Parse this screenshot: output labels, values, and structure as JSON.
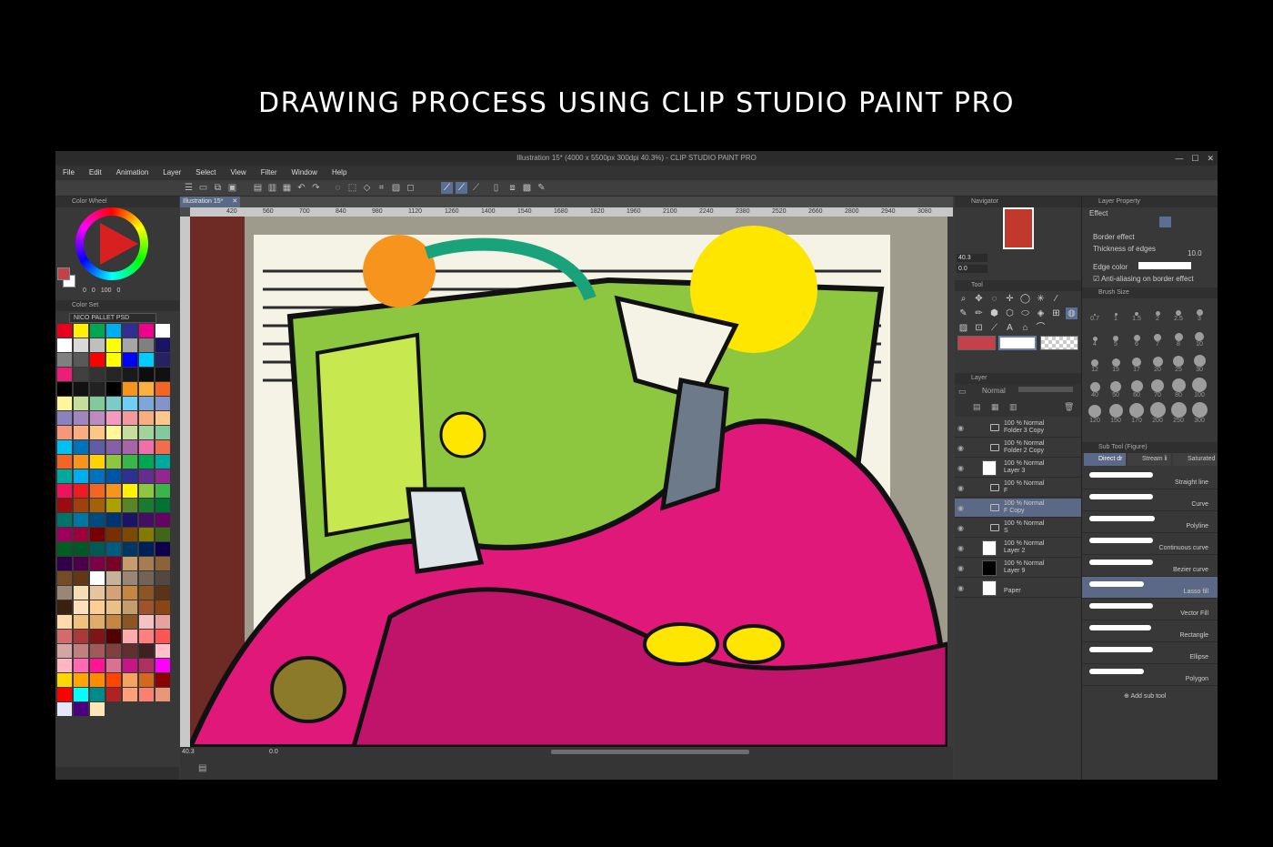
{
  "headline": "DRAWING PROCESS USING CLIP STUDIO PAINT PRO",
  "window": {
    "title": "Illustration 15* (4000 x 5500px 300dpi 40.3%)  - CLIP STUDIO PAINT PRO"
  },
  "menu": [
    "File",
    "Edit",
    "Animation",
    "Layer",
    "Select",
    "View",
    "Filter",
    "Window",
    "Help"
  ],
  "document_tab": "Illustration 15*",
  "ruler_labels": [
    "420",
    "560",
    "700",
    "840",
    "980",
    "1120",
    "1260",
    "1400",
    "1540",
    "1680",
    "1820",
    "1960",
    "2100",
    "2240",
    "2380",
    "2520",
    "2660",
    "2800",
    "2940",
    "3080",
    "3220"
  ],
  "color_wheel": {
    "title": "Color Wheel",
    "values": [
      "0",
      "0",
      "100",
      "0"
    ],
    "main_color": "#c4414a",
    "sub_color": "#ffffff"
  },
  "color_set": {
    "title": "Color Set",
    "palette": "NICO PALLET PSD",
    "swatches": [
      "#e8001c",
      "#ffef00",
      "#00a651",
      "#00aeef",
      "#2e3192",
      "#ec008c",
      "#ffffff",
      "#ffffff",
      "#d9d9d9",
      "#bfbfbf",
      "#ffff00",
      "#a6a6a6",
      "#808080",
      "#1b1464",
      "#808080",
      "#595959",
      "#ff0000",
      "#ffff00",
      "#0000ff",
      "#00ccff",
      "#262262",
      "#ed1e79",
      "#404040",
      "#333333",
      "#262626",
      "#1a1a1a",
      "#0d0d0d",
      "#111111",
      "#000000",
      "#111111",
      "#222222",
      "#000000",
      "#f7941d",
      "#fbb040",
      "#f26522",
      "#fff799",
      "#c4df9b",
      "#82ca9c",
      "#7accc8",
      "#6dcff6",
      "#7da7d9",
      "#8493ca",
      "#8882be",
      "#a186be",
      "#bc8cbf",
      "#f49ac1",
      "#f5989d",
      "#f9ad81",
      "#fdc68a",
      "#f7977a",
      "#f9ad81",
      "#fdc689",
      "#fff79a",
      "#c4df9b",
      "#a3d39c",
      "#82ca9d",
      "#00bff3",
      "#0072bc",
      "#605ca8",
      "#8560a8",
      "#a864a8",
      "#f06eaa",
      "#f26c4f",
      "#f26522",
      "#f7941d",
      "#ffd200",
      "#8dc63f",
      "#39b54a",
      "#00a651",
      "#00a99d",
      "#00a99d",
      "#00aeef",
      "#0072bc",
      "#0054a6",
      "#2e3192",
      "#662d91",
      "#92278f",
      "#ed145b",
      "#ed1c24",
      "#f26522",
      "#f7941d",
      "#fff200",
      "#8dc63f",
      "#39b54a",
      "#9e0b0f",
      "#a0410d",
      "#a36209",
      "#aba000",
      "#598527",
      "#1a7b30",
      "#007236",
      "#00746b",
      "#0076a3",
      "#004b80",
      "#003471",
      "#1b1464",
      "#440e62",
      "#630460",
      "#9e005d",
      "#9e0039",
      "#790000",
      "#7b2e00",
      "#7d4900",
      "#827b00",
      "#406618",
      "#005e20",
      "#005826",
      "#005952",
      "#005b7f",
      "#003663",
      "#002157",
      "#0d004c",
      "#32004b",
      "#4b0049",
      "#7b0046",
      "#7a0026",
      "#c69c6d",
      "#a67c52",
      "#8c6239",
      "#754c24",
      "#603913",
      "#ffffff",
      "#c7b299",
      "#998675",
      "#736357",
      "#534741",
      "#998675",
      "#f5deb3",
      "#e8c39e",
      "#d4a276",
      "#c68642",
      "#8d5524",
      "#5c3317",
      "#3b2010",
      "#ffe0bd",
      "#ffcd94",
      "#eac086",
      "#c69c6d",
      "#a0522d",
      "#8b4513",
      "#ffdbac",
      "#f1c27d",
      "#e0ac69",
      "#c68642",
      "#8d5524",
      "#f4c2c2",
      "#e8a0a0",
      "#d46a6a",
      "#aa3939",
      "#801515",
      "#550000",
      "#ffaaaa",
      "#ff7f7f",
      "#ff5555",
      "#d4a5a5",
      "#c08080",
      "#a05a5a",
      "#804040",
      "#603030",
      "#402020",
      "#ffc0cb",
      "#ffb6c1",
      "#ff69b4",
      "#ff1493",
      "#db7093",
      "#c71585",
      "#b03060",
      "#ff00ff",
      "#ffd700",
      "#ffa500",
      "#ff8c00",
      "#ff4500",
      "#f4a460",
      "#d2691e",
      "#8b0000",
      "#ff0000",
      "#00ffff",
      "#008b8b",
      "#b22222",
      "#ffa07a",
      "#fa8072",
      "#e9967a",
      "#e6e6fa",
      "#4b0082",
      "#ffe4b5"
    ]
  },
  "navigator": {
    "title": "Navigator",
    "zoom": "40.3",
    "angle": "0.0"
  },
  "tool": {
    "title": "Tool"
  },
  "layer": {
    "title": "Layer",
    "blend": "Normal",
    "rows": [
      {
        "pct": "100 % Normal",
        "name": "Folder 3 Copy"
      },
      {
        "pct": "100 % Normal",
        "name": "Folder 2 Copy"
      },
      {
        "pct": "100 % Normal",
        "name": "Layer 3"
      },
      {
        "pct": "100 % Normal",
        "name": "F"
      },
      {
        "pct": "100 % Normal",
        "name": "F Copy"
      },
      {
        "pct": "100 % Normal",
        "name": "S"
      },
      {
        "pct": "100 % Normal",
        "name": "Layer 2"
      },
      {
        "pct": "100 % Normal",
        "name": "Layer 9"
      },
      {
        "pct": "",
        "name": "Paper"
      }
    ]
  },
  "layer_property": {
    "title": "Layer Property",
    "effect": "Effect",
    "border_effect": "Border effect",
    "thickness": "Thickness of edges",
    "thickness_val": "10.0",
    "edge_color": "Edge color",
    "anti_alias": "Anti-aliasing on border effect"
  },
  "brush_size": {
    "title": "Brush Size",
    "sizes": [
      "0.7",
      "1",
      "1.5",
      "2",
      "2.5",
      "3",
      "4",
      "5",
      "6",
      "7",
      "8",
      "10",
      "12",
      "15",
      "17",
      "20",
      "25",
      "30",
      "40",
      "50",
      "60",
      "70",
      "80",
      "100",
      "120",
      "150",
      "170",
      "200",
      "250",
      "300"
    ]
  },
  "sub_tool": {
    "title": "Sub Tool (Figure)",
    "tabs": [
      "Direct dr",
      "Stream li",
      "Saturated"
    ],
    "items": [
      "Straight line",
      "Curve",
      "Polyline",
      "Continuous curve",
      "Bezier curve",
      "Lasso fill",
      "Vector Fill",
      "Rectangle",
      "Ellipse",
      "Polygon"
    ],
    "add": "Add sub tool"
  },
  "canvas_footer": {
    "zoom": "40.3",
    "angle": "0.0"
  }
}
